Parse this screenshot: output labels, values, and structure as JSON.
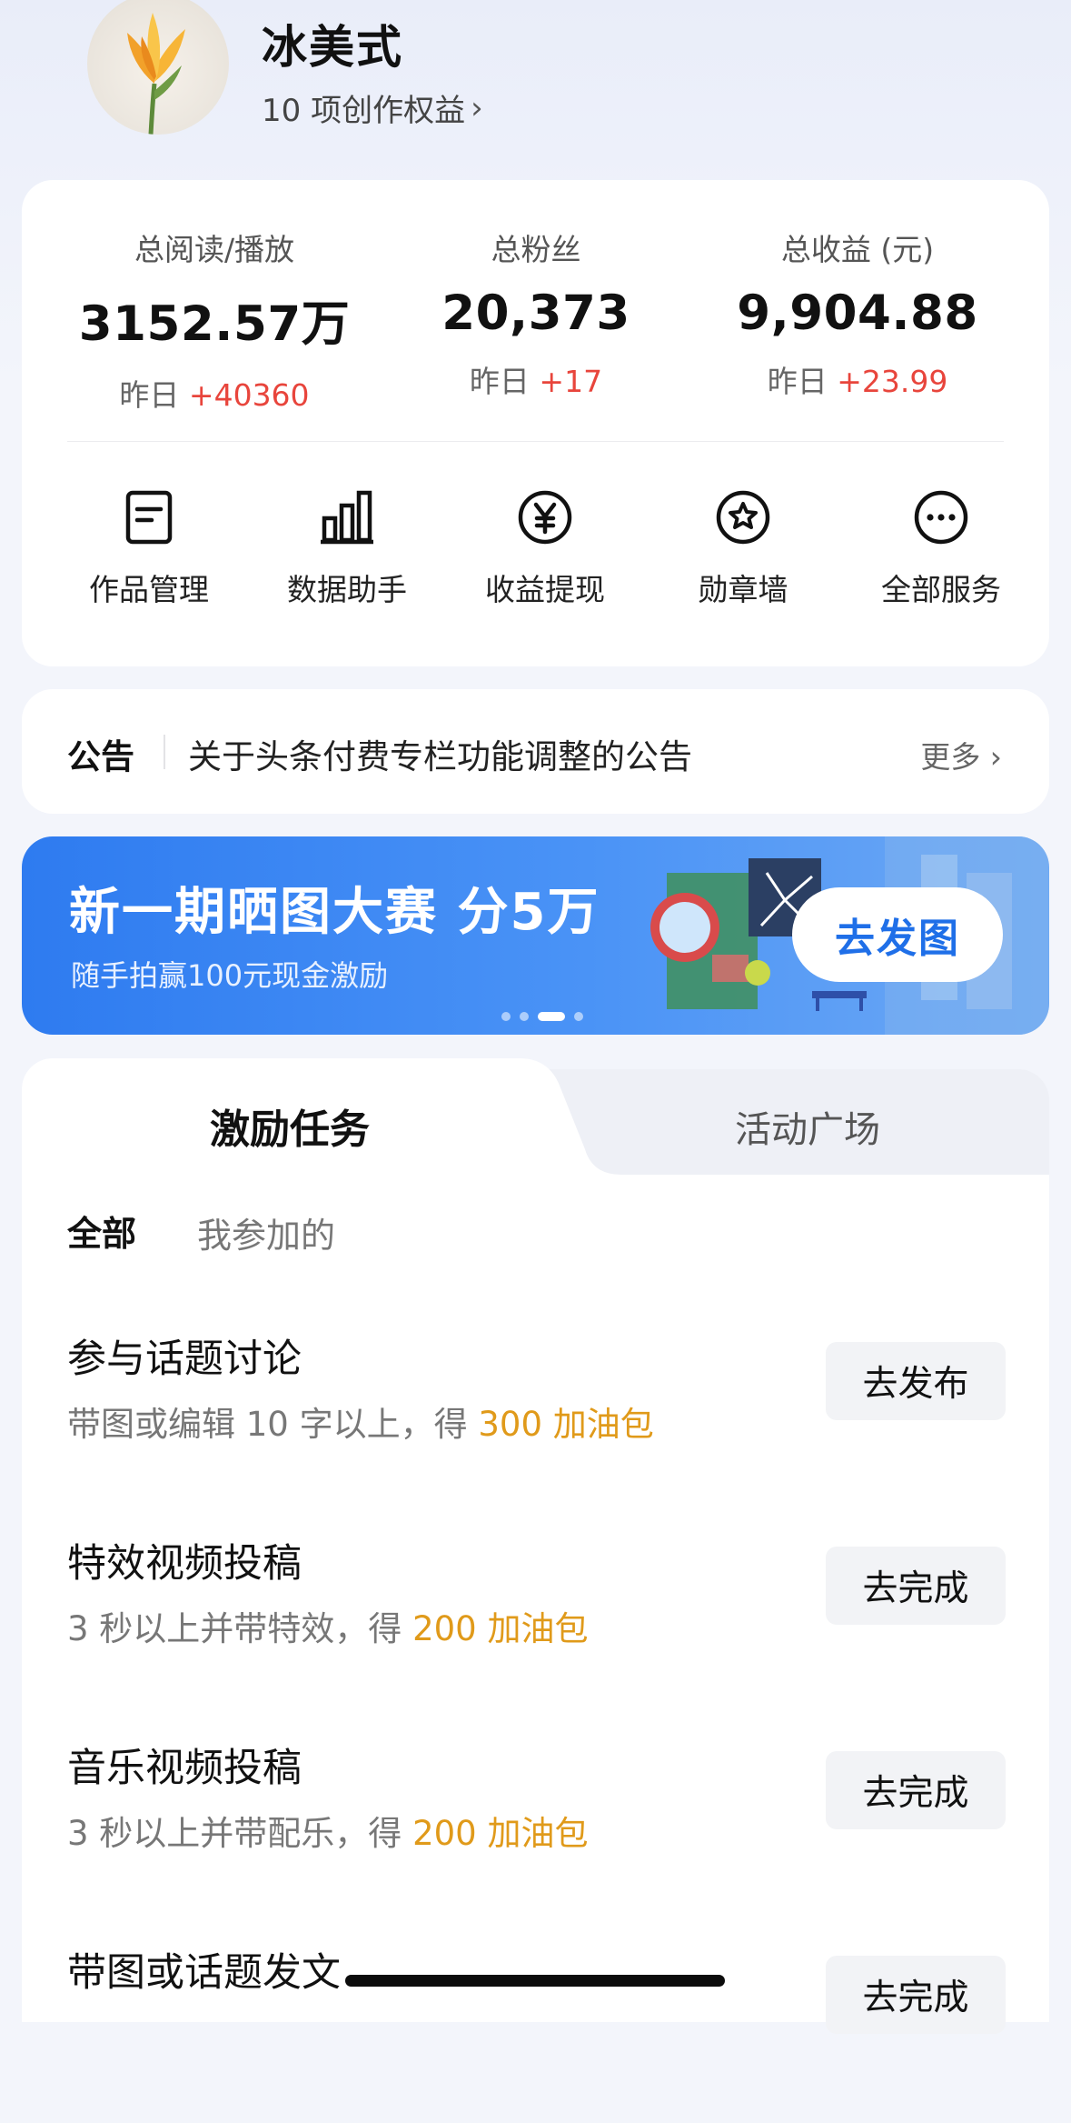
{
  "profile": {
    "name": "冰美式",
    "rights_text": "10 项创作权益",
    "chevron": "›"
  },
  "stats": [
    {
      "label": "总阅读/播放",
      "value": "3152.57万",
      "delta_prefix": "昨日 ",
      "delta": "+40360"
    },
    {
      "label": "总粉丝",
      "value": "20,373",
      "delta_prefix": "昨日 ",
      "delta": "+17"
    },
    {
      "label": "总收益 (元)",
      "value": "9,904.88",
      "delta_prefix": "昨日 ",
      "delta": "+23.99"
    }
  ],
  "tools": [
    {
      "label": "作品管理",
      "icon": "document-icon"
    },
    {
      "label": "数据助手",
      "icon": "bar-chart-icon"
    },
    {
      "label": "收益提现",
      "icon": "yen-icon"
    },
    {
      "label": "勋章墙",
      "icon": "medal-star-icon"
    },
    {
      "label": "全部服务",
      "icon": "more-dots-icon"
    }
  ],
  "notice": {
    "tag": "公告",
    "text": "关于头条付费专栏功能调整的公告",
    "more": "更多 ›"
  },
  "banner": {
    "title": "新一期晒图大赛 分5万",
    "subtitle": "随手拍赢100元现金激励",
    "button": "去发图",
    "pages": 4,
    "active_page": 3
  },
  "tasks": {
    "tabs": [
      "激励任务",
      "活动广场"
    ],
    "active_tab": 0,
    "filters": [
      "全部",
      "我参加的"
    ],
    "items": [
      {
        "title": "参与话题讨论",
        "desc": "带图或编辑 10 字以上，得 ",
        "reward": "300 加油包",
        "button": "去发布"
      },
      {
        "title": "特效视频投稿",
        "desc": "3 秒以上并带特效，得 ",
        "reward": "200 加油包",
        "button": "去完成"
      },
      {
        "title": "音乐视频投稿",
        "desc": "3 秒以上并带配乐，得 ",
        "reward": "200 加油包",
        "button": "去完成"
      },
      {
        "title": "带图或话题发文",
        "desc": "",
        "reward": "",
        "button": "去完成"
      }
    ]
  },
  "colors": {
    "accent_blue": "#2e7bf0",
    "delta_red": "#e8453c",
    "reward_orange": "#e09a1a",
    "background": "#f3f5fb"
  }
}
